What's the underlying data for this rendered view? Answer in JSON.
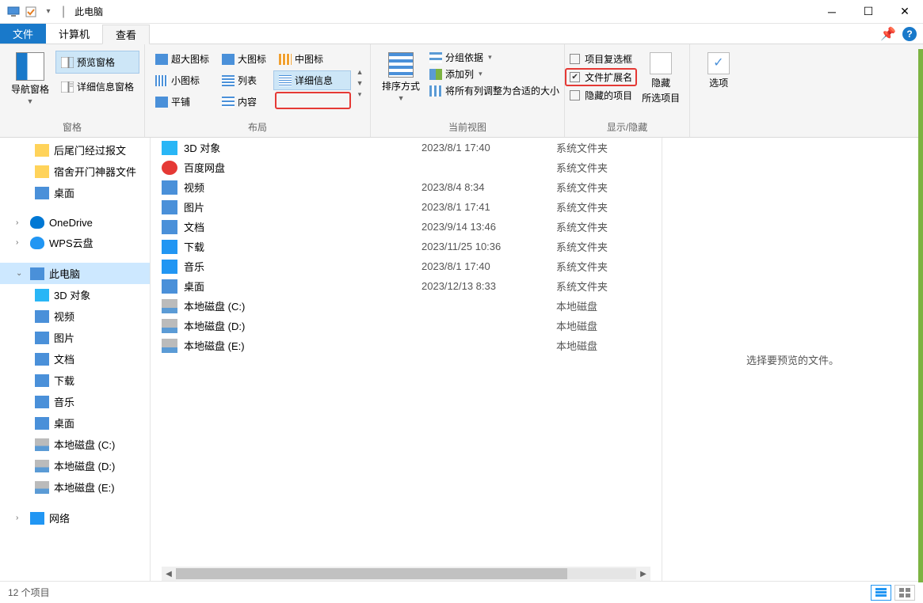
{
  "titlebar": {
    "title": "此电脑",
    "qat_checked": true
  },
  "tabs": {
    "file": "文件",
    "computer": "计算机",
    "view": "查看"
  },
  "ribbon": {
    "panes": {
      "nav_pane": "导航窗格",
      "preview_pane": "预览窗格",
      "detail_pane": "详细信息窗格",
      "group_label": "窗格"
    },
    "layout": {
      "xl_icons": "超大图标",
      "l_icons": "大图标",
      "m_icons": "中图标",
      "s_icons": "小图标",
      "list": "列表",
      "details": "详细信息",
      "tiles": "平铺",
      "content": "内容",
      "group_label": "布局"
    },
    "current_view": {
      "sort": "排序方式",
      "group_by": "分组依据",
      "add_columns": "添加列",
      "size_all": "将所有列调整为合适的大小",
      "group_label": "当前视图"
    },
    "show_hide": {
      "item_checkboxes": "项目复选框",
      "file_ext": "文件扩展名",
      "hidden_items": "隐藏的项目",
      "hide_selected": "隐藏",
      "hide_selected_sub": "所选项目",
      "group_label": "显示/隐藏"
    },
    "options": "选项"
  },
  "sidebar": {
    "items": [
      {
        "label": "后尾门经过报文",
        "icon": "folder",
        "level": "l2"
      },
      {
        "label": "宿舍开门神器文件",
        "icon": "folder",
        "level": "l2"
      },
      {
        "label": "桌面",
        "icon": "desktop",
        "level": "l2"
      },
      {
        "label": "OneDrive",
        "icon": "onedrive",
        "level": "l1",
        "expander": "›"
      },
      {
        "label": "WPS云盘",
        "icon": "wps",
        "level": "l1",
        "expander": "›"
      },
      {
        "label": "此电脑",
        "icon": "pc",
        "level": "l1",
        "expander": "⌄",
        "selected": true
      },
      {
        "label": "3D 对象",
        "icon": "3d",
        "level": "l2",
        "expander": "›"
      },
      {
        "label": "视频",
        "icon": "video",
        "level": "l2",
        "expander": "›"
      },
      {
        "label": "图片",
        "icon": "pic",
        "level": "l2",
        "expander": "›"
      },
      {
        "label": "文档",
        "icon": "doc",
        "level": "l2",
        "expander": "›"
      },
      {
        "label": "下载",
        "icon": "download",
        "level": "l2",
        "expander": "›"
      },
      {
        "label": "音乐",
        "icon": "music",
        "level": "l2",
        "expander": "›"
      },
      {
        "label": "桌面",
        "icon": "desktop",
        "level": "l2",
        "expander": "›"
      },
      {
        "label": "本地磁盘 (C:)",
        "icon": "disk",
        "level": "l2",
        "expander": "›"
      },
      {
        "label": "本地磁盘 (D:)",
        "icon": "disk",
        "level": "l2",
        "expander": "›"
      },
      {
        "label": "本地磁盘 (E:)",
        "icon": "disk",
        "level": "l2",
        "expander": "›"
      },
      {
        "label": "网络",
        "icon": "network",
        "level": "l1",
        "expander": "›"
      }
    ]
  },
  "filelist": {
    "rows": [
      {
        "name": "3D 对象",
        "date": "2023/8/1 17:40",
        "type": "系统文件夹",
        "icon": "3d"
      },
      {
        "name": "百度网盘",
        "date": "",
        "type": "系统文件夹",
        "icon": "baidu"
      },
      {
        "name": "视频",
        "date": "2023/8/4 8:34",
        "type": "系统文件夹",
        "icon": "video"
      },
      {
        "name": "图片",
        "date": "2023/8/1 17:41",
        "type": "系统文件夹",
        "icon": "pic"
      },
      {
        "name": "文档",
        "date": "2023/9/14 13:46",
        "type": "系统文件夹",
        "icon": "doc"
      },
      {
        "name": "下载",
        "date": "2023/11/25 10:36",
        "type": "系统文件夹",
        "icon": "download"
      },
      {
        "name": "音乐",
        "date": "2023/8/1 17:40",
        "type": "系统文件夹",
        "icon": "music"
      },
      {
        "name": "桌面",
        "date": "2023/12/13 8:33",
        "type": "系统文件夹",
        "icon": "desktop"
      },
      {
        "name": "本地磁盘 (C:)",
        "date": "",
        "type": "本地磁盘",
        "icon": "disk"
      },
      {
        "name": "本地磁盘 (D:)",
        "date": "",
        "type": "本地磁盘",
        "icon": "disk"
      },
      {
        "name": "本地磁盘 (E:)",
        "date": "",
        "type": "本地磁盘",
        "icon": "disk"
      }
    ]
  },
  "preview": {
    "placeholder": "选择要预览的文件。"
  },
  "statusbar": {
    "item_count": "12 个项目"
  }
}
